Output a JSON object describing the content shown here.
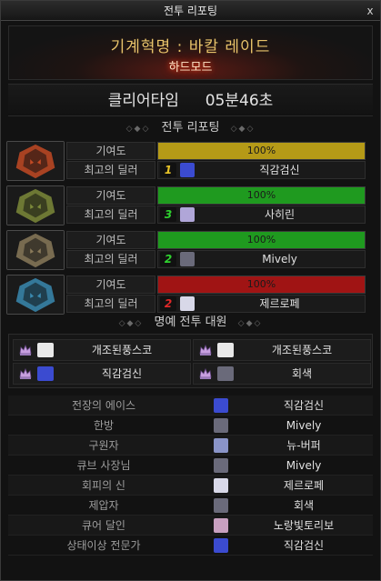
{
  "window": {
    "title": "전투 리포팅",
    "close_label": "x"
  },
  "header": {
    "raid_name": "기계혁명 : 바칼 레이드",
    "mode": "하드모드"
  },
  "clear": {
    "label": "클리어타임",
    "time": "05분46초"
  },
  "sections": {
    "report": "전투 리포팅",
    "honor": "명예 전투 대원",
    "deco_left": "◇◆◇",
    "deco_right": "◇◆◇"
  },
  "labels": {
    "contribution": "기여도",
    "best_dealer": "최고의 딜러"
  },
  "bosses": [
    {
      "contribution_text": "100%",
      "contribution": 1.0,
      "bar_color": "#b59a17",
      "rank": "1",
      "rank_color": "#e8c428",
      "dealer": "직감검신",
      "avatar_color": "#3b4bd0",
      "portrait_color": "#c24a24"
    },
    {
      "contribution_text": "100%",
      "contribution": 1.0,
      "bar_color": "#1f9a1f",
      "rank": "3",
      "rank_color": "#2fd22f",
      "dealer": "사히린",
      "avatar_color": "#b0a6d8",
      "portrait_color": "#7c8a3a"
    },
    {
      "contribution_text": "100%",
      "contribution": 1.0,
      "bar_color": "#1f9a1f",
      "rank": "2",
      "rank_color": "#2fd22f",
      "dealer": "Mively",
      "avatar_color": "#6a6a7a",
      "portrait_color": "#8a7a5a"
    },
    {
      "contribution_text": "100%",
      "contribution": 1.0,
      "bar_color": "#a01414",
      "rank": "2",
      "rank_color": "#e02828",
      "dealer": "제르로페",
      "avatar_color": "#d8d8e8",
      "portrait_color": "#3a8ab0"
    }
  ],
  "honor": [
    {
      "name": "개조된풍스코",
      "avatar_color": "#e8e8e8"
    },
    {
      "name": "개조된풍스코",
      "avatar_color": "#e8e8e8"
    },
    {
      "name": "직감검신",
      "avatar_color": "#3b4bd0"
    },
    {
      "name": "회색",
      "avatar_color": "#6a6a7a"
    }
  ],
  "awards": [
    {
      "title": "전장의 에이스",
      "name": "직감검신",
      "avatar_color": "#3b4bd0"
    },
    {
      "title": "한방",
      "name": "Mively",
      "avatar_color": "#6a6a7a"
    },
    {
      "title": "구원자",
      "name": "뉴-버퍼",
      "avatar_color": "#8a94c8"
    },
    {
      "title": "큐브 사장님",
      "name": "Mively",
      "avatar_color": "#6a6a7a"
    },
    {
      "title": "회피의 신",
      "name": "제르로페",
      "avatar_color": "#d8d8e8"
    },
    {
      "title": "제압자",
      "name": "회색",
      "avatar_color": "#6a6a7a"
    },
    {
      "title": "큐어 달인",
      "name": "노랑빛토리보",
      "avatar_color": "#c8a0c0"
    },
    {
      "title": "상태이상 전문가",
      "name": "직감검신",
      "avatar_color": "#3b4bd0"
    }
  ],
  "icons": {
    "crown": "crown-icon",
    "close": "close-icon"
  }
}
